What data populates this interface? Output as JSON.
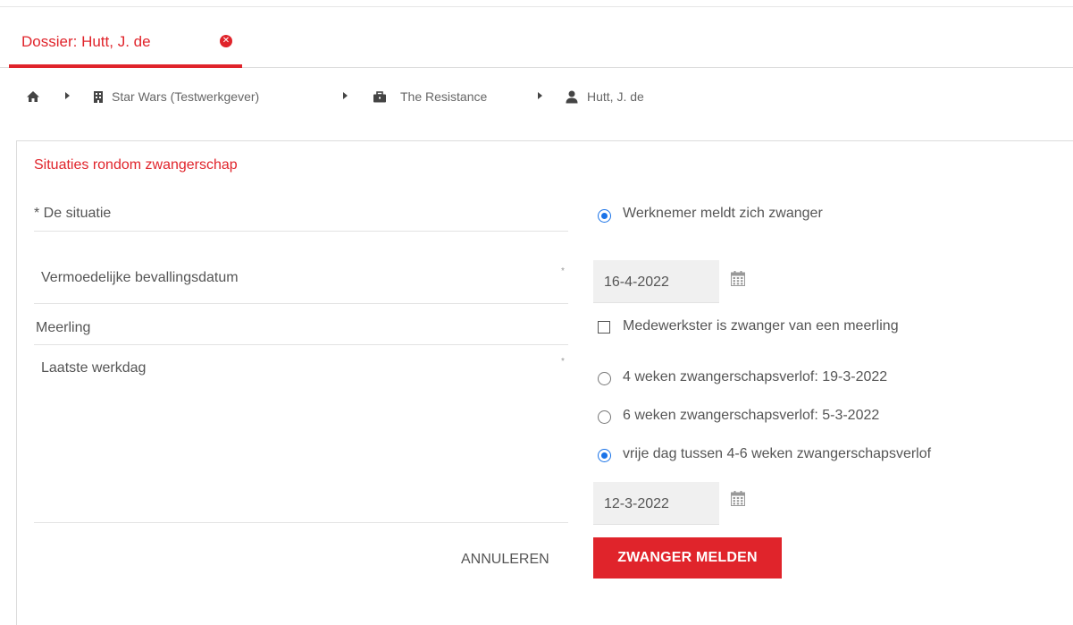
{
  "tab": {
    "title": "Dossier: Hutt, J. de",
    "close_icon": "close-circle-icon"
  },
  "breadcrumb": {
    "home_icon": "home-icon",
    "items": [
      {
        "label": "Star Wars (Testwerkgever)",
        "icon": "building-icon"
      },
      {
        "label": "The Resistance",
        "icon": "briefcase-icon"
      },
      {
        "label": "Hutt, J. de",
        "icon": "user-icon"
      }
    ]
  },
  "form": {
    "title": "Situaties rondom zwangerschap",
    "situatie": {
      "label": "* De situatie",
      "option": "Werknemer meldt zich zwanger",
      "checked": true
    },
    "bevallingsdatum": {
      "label": "Vermoedelijke bevallingsdatum",
      "required_mark": "*",
      "value": "16-4-2022"
    },
    "meerling": {
      "label": "Meerling",
      "checkbox_label": "Medewerkster is zwanger van een meerling",
      "checked": false
    },
    "laatste_werkdag": {
      "label": "Laatste werkdag",
      "required_mark": "*",
      "options": [
        {
          "label": "4 weken zwangerschapsverlof: 19-3-2022",
          "checked": false
        },
        {
          "label": "6 weken zwangerschapsverlof: 5-3-2022",
          "checked": false
        },
        {
          "label": "vrije dag tussen 4-6 weken zwangerschapsverlof",
          "checked": true
        }
      ],
      "custom_date": "12-3-2022"
    },
    "buttons": {
      "cancel": "ANNULEREN",
      "submit": "ZWANGER MELDEN"
    }
  },
  "colors": {
    "accent": "#e0242b",
    "radio": "#1a73e8",
    "text": "#555555",
    "input_bg": "#f0f0f0"
  }
}
